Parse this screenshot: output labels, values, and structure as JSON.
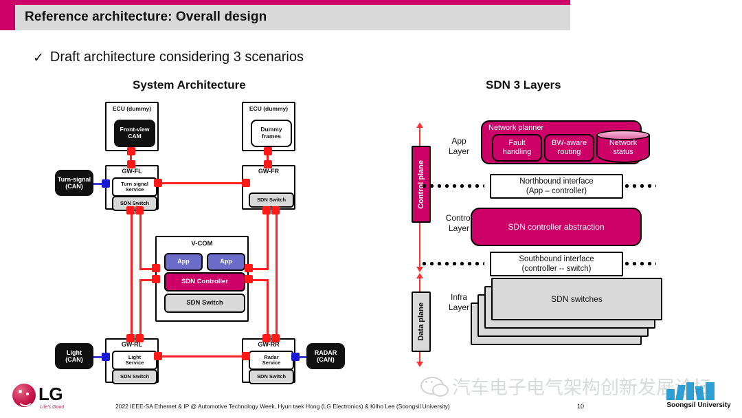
{
  "slide": {
    "title": "Reference architecture: Overall design",
    "bullet_mark": "✓",
    "bullet_text": "Draft architecture considering 3 scenarios",
    "accent_color": "#cc0066",
    "page_number": "10",
    "footer": "2022 IEEE-SA Ethernet & IP @ Automotive Technology Week, Hyun taek Hong (LG Electronics) & Kilho Lee (Soongsil University)"
  },
  "left_diagram": {
    "heading": "System Architecture",
    "ecu_fl": {
      "title": "ECU (dummy)",
      "inner": "Front-view\nCAM"
    },
    "ecu_fr": {
      "title": "ECU (dummy)",
      "inner": "Dummy\nframes"
    },
    "gw_fl": {
      "title": "GW-FL",
      "service": "Turn signal\nService",
      "switch": "SDN Switch"
    },
    "gw_fr": {
      "title": "GW-FR",
      "switch": "SDN Switch"
    },
    "gw_rl": {
      "title": "GW-RL",
      "service": "Light\nService",
      "switch": "SDN Switch"
    },
    "gw_rr": {
      "title": "GW-RR",
      "service": "Radar\nService",
      "switch": "SDN Switch"
    },
    "can_turn_signal": "Turn-signal\n(CAN)",
    "can_light": "Light\n(CAN)",
    "can_radar": "RADAR\n(CAN)",
    "vcom": {
      "title": "V-COM",
      "app_left": "App",
      "app_right": "App",
      "controller": "SDN Controller",
      "switch": "SDN Switch"
    }
  },
  "right_diagram": {
    "heading": "SDN 3 Layers",
    "planes": [
      {
        "label": "Control plane",
        "color": "#cc0066"
      },
      {
        "label": "Data plane",
        "color": "#d9d9d9"
      }
    ],
    "layers": [
      {
        "label": "App\nLayer"
      },
      {
        "label": "Control\nLayer"
      },
      {
        "label": "Infra\nLayer"
      }
    ],
    "network_planner": {
      "title": "Network planner",
      "modules": [
        "Fault\nhandling",
        "BW-aware\nrouting"
      ],
      "datastore": "Network\nstatus"
    },
    "northbound": {
      "line1": "Northbound interface",
      "line2": "(App – controller)"
    },
    "controller_abstraction": "SDN controller abstraction",
    "southbound": {
      "line1": "Southbound interface",
      "line2": "(controller -- switch)"
    },
    "switches": "SDN switches"
  },
  "branding": {
    "lg_word": "LG",
    "lg_tagline": "Life's Good",
    "watermark_text": "汽车电子电气架构创新发展论坛",
    "soongsil_name": "Soongsil University"
  }
}
